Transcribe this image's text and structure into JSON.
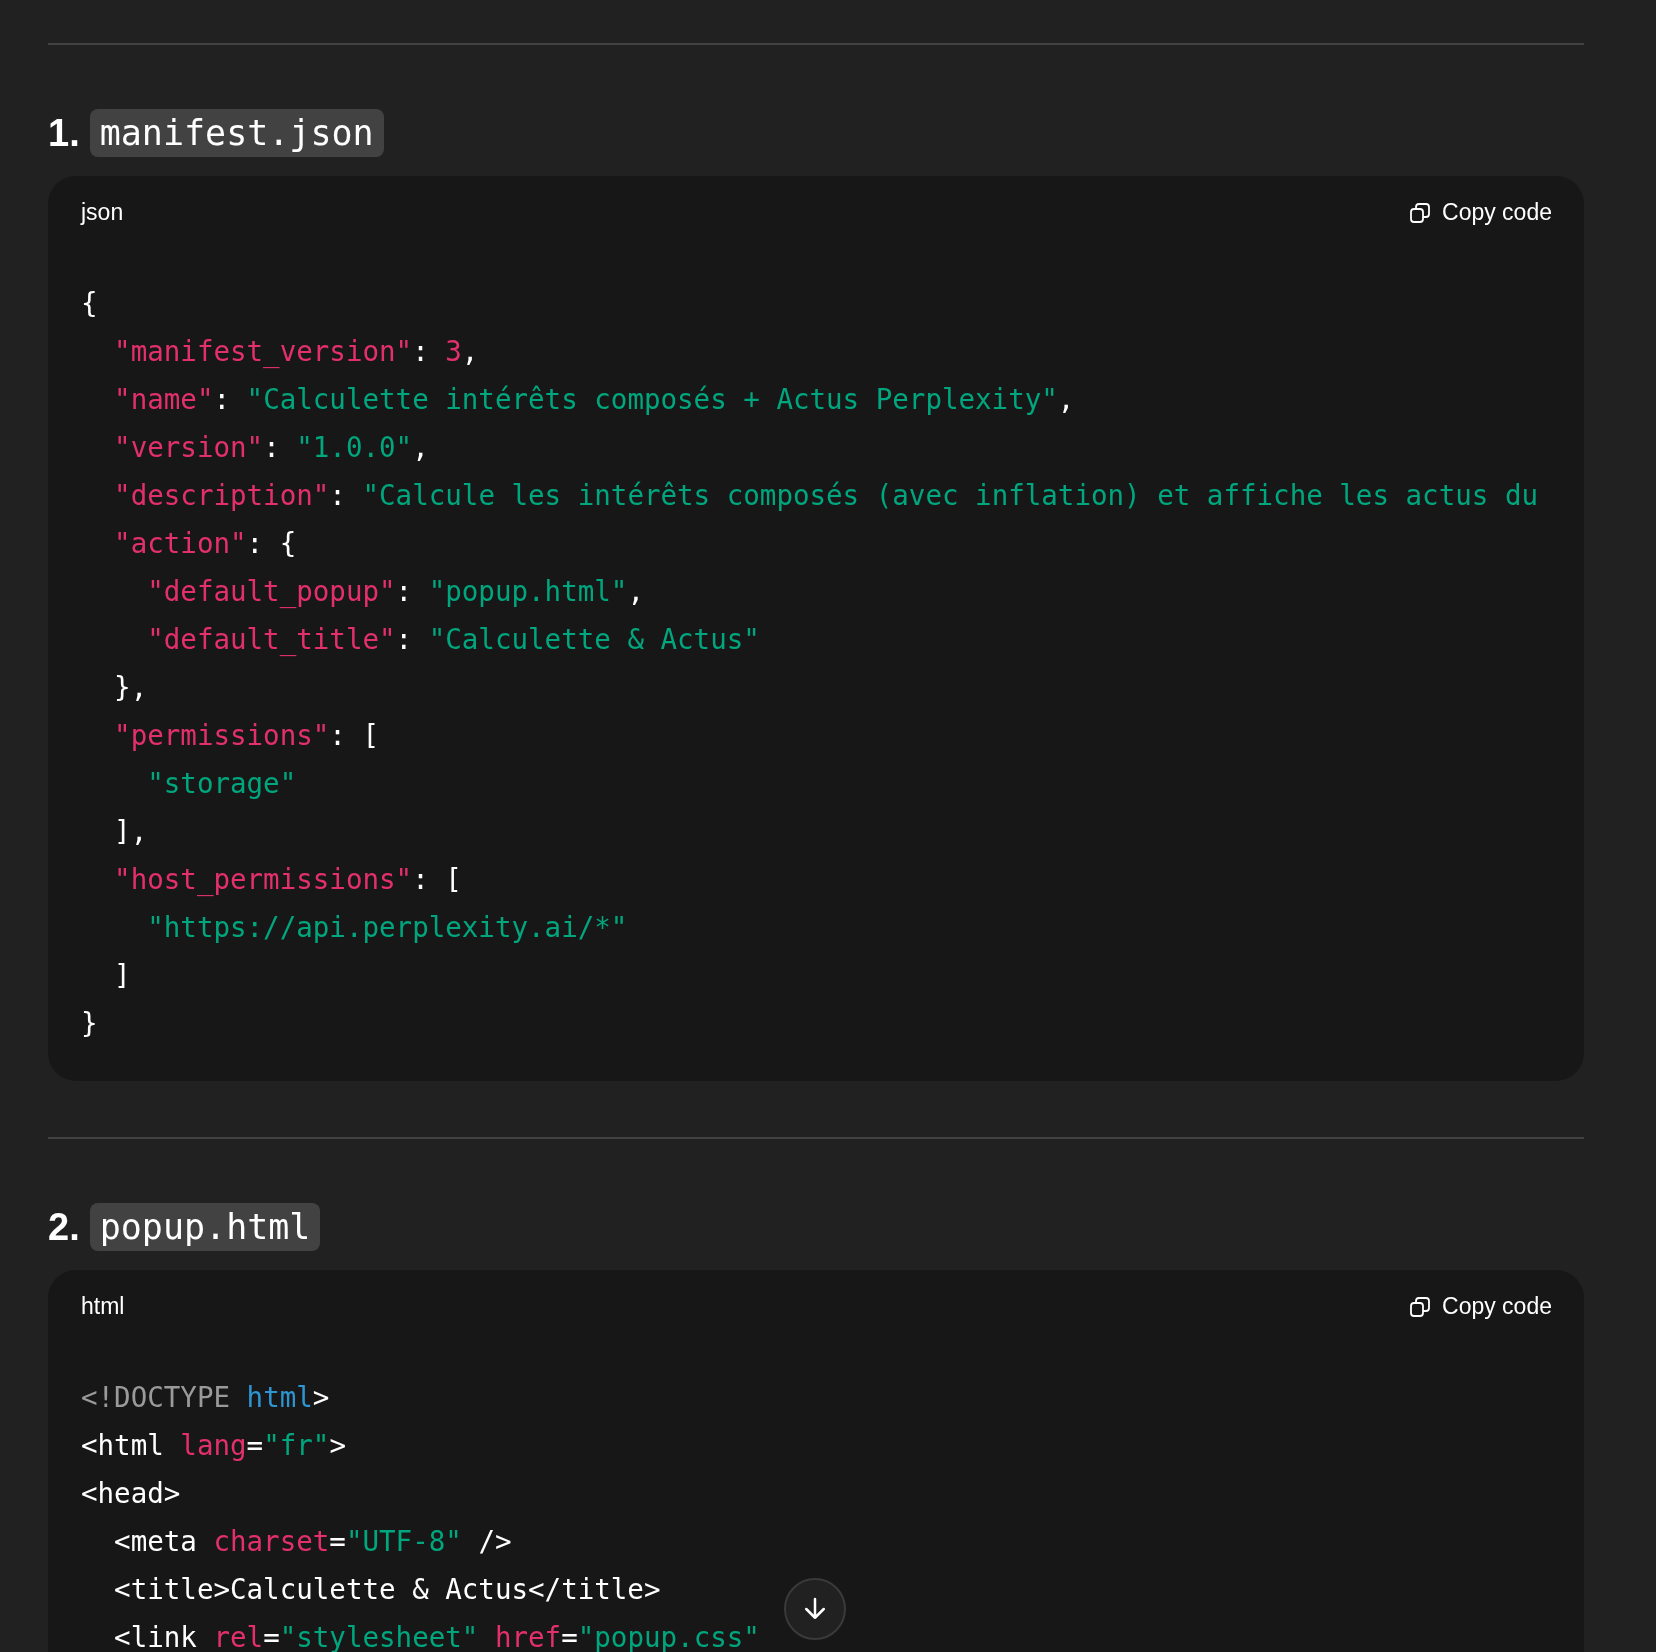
{
  "sections": [
    {
      "number": "1.",
      "filename": "manifest.json",
      "language": "json",
      "copy_label": "Copy code",
      "lines": [
        [
          {
            "t": "{",
            "kind": "plain"
          }
        ],
        [
          {
            "t": "  \"manifest_version\"",
            "kind": "key"
          },
          {
            "t": ": ",
            "kind": "plain"
          },
          {
            "t": "3",
            "kind": "number"
          },
          {
            "t": ",",
            "kind": "plain"
          }
        ],
        [
          {
            "t": "  \"name\"",
            "kind": "key"
          },
          {
            "t": ": ",
            "kind": "plain"
          },
          {
            "t": "\"Calculette intérêts composés + Actus Perplexity\"",
            "kind": "string"
          },
          {
            "t": ",",
            "kind": "plain"
          }
        ],
        [
          {
            "t": "  \"version\"",
            "kind": "key"
          },
          {
            "t": ": ",
            "kind": "plain"
          },
          {
            "t": "\"1.0.0\"",
            "kind": "string"
          },
          {
            "t": ",",
            "kind": "plain"
          }
        ],
        [
          {
            "t": "  \"description\"",
            "kind": "key"
          },
          {
            "t": ": ",
            "kind": "plain"
          },
          {
            "t": "\"Calcule les intérêts composés (avec inflation) et affiche les actus du",
            "kind": "string"
          }
        ],
        [
          {
            "t": "  \"action\"",
            "kind": "key"
          },
          {
            "t": ": {",
            "kind": "plain"
          }
        ],
        [
          {
            "t": "    \"default_popup\"",
            "kind": "key"
          },
          {
            "t": ": ",
            "kind": "plain"
          },
          {
            "t": "\"popup.html\"",
            "kind": "string"
          },
          {
            "t": ",",
            "kind": "plain"
          }
        ],
        [
          {
            "t": "    \"default_title\"",
            "kind": "key"
          },
          {
            "t": ": ",
            "kind": "plain"
          },
          {
            "t": "\"Calculette & Actus\"",
            "kind": "string"
          }
        ],
        [
          {
            "t": "  },",
            "kind": "plain"
          }
        ],
        [
          {
            "t": "  \"permissions\"",
            "kind": "key"
          },
          {
            "t": ": [",
            "kind": "plain"
          }
        ],
        [
          {
            "t": "    \"storage\"",
            "kind": "string"
          }
        ],
        [
          {
            "t": "  ],",
            "kind": "plain"
          }
        ],
        [
          {
            "t": "  \"host_permissions\"",
            "kind": "key"
          },
          {
            "t": ": [",
            "kind": "plain"
          }
        ],
        [
          {
            "t": "    \"https://api.perplexity.ai/*\"",
            "kind": "string"
          }
        ],
        [
          {
            "t": "  ]",
            "kind": "plain"
          }
        ],
        [
          {
            "t": "}",
            "kind": "plain"
          }
        ]
      ]
    },
    {
      "number": "2.",
      "filename": "popup.html",
      "language": "html",
      "copy_label": "Copy code",
      "lines": [
        [
          {
            "t": "<!DOCTYPE ",
            "kind": "doctype"
          },
          {
            "t": "html",
            "kind": "tag"
          },
          {
            "t": ">",
            "kind": "plain"
          }
        ],
        [
          {
            "t": "<html ",
            "kind": "plain"
          },
          {
            "t": "lang",
            "kind": "key"
          },
          {
            "t": "=",
            "kind": "plain"
          },
          {
            "t": "\"fr\"",
            "kind": "string"
          },
          {
            "t": ">",
            "kind": "plain"
          }
        ],
        [
          {
            "t": "<head>",
            "kind": "plain"
          }
        ],
        [
          {
            "t": "  <meta ",
            "kind": "plain"
          },
          {
            "t": "charset",
            "kind": "key"
          },
          {
            "t": "=",
            "kind": "plain"
          },
          {
            "t": "\"UTF-8\"",
            "kind": "string"
          },
          {
            "t": " />",
            "kind": "plain"
          }
        ],
        [
          {
            "t": "  <title>Calculette & Actus</title>",
            "kind": "plain"
          }
        ],
        [
          {
            "t": "  <link ",
            "kind": "plain"
          },
          {
            "t": "rel",
            "kind": "key"
          },
          {
            "t": "=",
            "kind": "plain"
          },
          {
            "t": "\"stylesheet\"",
            "kind": "string"
          },
          {
            "t": " href",
            "kind": "key"
          },
          {
            "t": "=",
            "kind": "plain"
          },
          {
            "t": "\"popup.css\"",
            "kind": "string"
          }
        ]
      ]
    }
  ]
}
